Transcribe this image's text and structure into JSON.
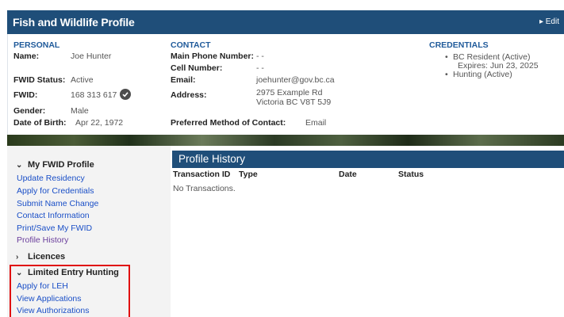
{
  "header": {
    "title": "Fish and Wildlife Profile",
    "edit_label": "▸ Edit"
  },
  "personal": {
    "title": "PERSONAL",
    "name_label": "Name:",
    "name": "Joe Hunter",
    "status_label": "FWID Status:",
    "status": "Active",
    "fwid_label": "FWID:",
    "fwid": "168 313 617",
    "gender_label": "Gender:",
    "gender": "Male",
    "dob_label": "Date of Birth:",
    "dob": "Apr 22, 1972"
  },
  "contact": {
    "title": "CONTACT",
    "main_phone_label": "Main Phone Number:",
    "main_phone": "- -",
    "cell_label": "Cell Number:",
    "cell": "- -",
    "email_label": "Email:",
    "email": "joehunter@gov.bc.ca",
    "address_label": "Address:",
    "address_line1": "2975 Example Rd",
    "address_line2": "Victoria BC V8T 5J9",
    "preferred_label": "Preferred Method of Contact:",
    "preferred": "Email"
  },
  "credentials": {
    "title": "CREDENTIALS",
    "items": [
      "BC Resident (Active)",
      "Expires: Jun 23, 2025",
      "Hunting (Active)"
    ]
  },
  "sidebar": {
    "fwid_section": "My FWID Profile",
    "fwid_links": [
      "Update Residency",
      "Apply for Credentials",
      "Submit Name Change",
      "Contact Information",
      "Print/Save My FWID",
      "Profile History"
    ],
    "licences_section": "Licences",
    "leh_section": "Limited Entry Hunting",
    "leh_links": [
      "Apply for LEH",
      "View Applications",
      "View Authorizations"
    ]
  },
  "profile_history": {
    "title": "Profile History",
    "columns": [
      "Transaction ID",
      "Type",
      "Date",
      "Status"
    ],
    "empty_text": "No Transactions."
  },
  "colors": {
    "header_bg": "#1f4e79",
    "link": "#1a4fc7",
    "visited_link": "#6a3e9c",
    "section_title": "#1f5a9a",
    "highlight": "#e01010"
  }
}
